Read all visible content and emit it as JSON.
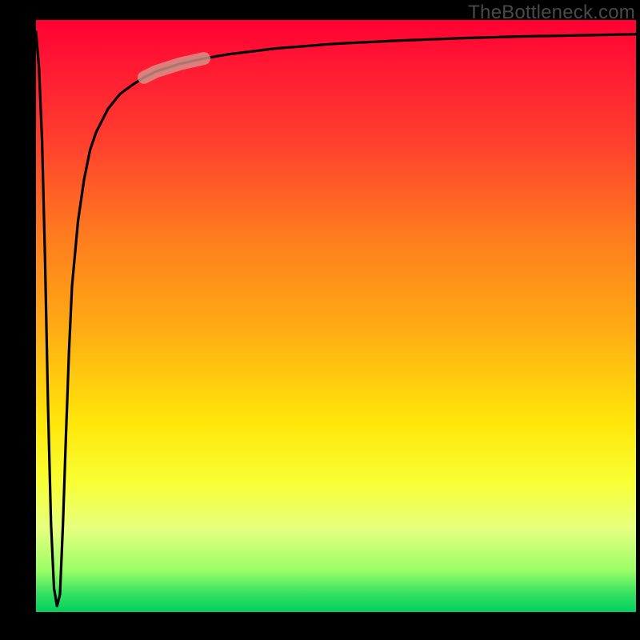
{
  "watermark": "TheBottleneck.com",
  "colors": {
    "background": "#000000",
    "gradient_top": "#ff0033",
    "gradient_mid": "#ffe60a",
    "gradient_bottom": "#00d060",
    "curve": "#000000",
    "highlight": "#d49b8e"
  },
  "chart_data": {
    "type": "line",
    "title": "",
    "xlabel": "",
    "ylabel": "",
    "xlim": [
      0,
      100
    ],
    "ylim": [
      0,
      100
    ],
    "grid": false,
    "legend": false,
    "annotations": [
      "TheBottleneck.com"
    ],
    "description": "Single black curve on a vertical red-to-green gradient background. The curve starts near the top-left, plunges almost vertically to the bottom-left corner, then rises steeply and asymptotically flattens toward the top-right. A short pale-pink highlighted band sits on the curve during the sharp upper-left ascent.",
    "series": [
      {
        "name": "bottleneck-curve",
        "x": [
          0.0,
          0.5,
          1.0,
          1.5,
          2.0,
          2.5,
          3.0,
          3.5,
          4.0,
          4.5,
          5.0,
          5.5,
          6.0,
          7.0,
          8.0,
          9.0,
          10.0,
          12.0,
          14.0,
          16.0,
          18.0,
          20.0,
          24.0,
          28.0,
          32.0,
          40.0,
          50.0,
          60.0,
          70.0,
          80.0,
          90.0,
          100.0
        ],
        "y": [
          98.0,
          92.0,
          80.0,
          60.0,
          35.0,
          15.0,
          4.0,
          1.0,
          3.0,
          15.0,
          30.0,
          44.0,
          55.0,
          66.0,
          73.0,
          78.0,
          81.0,
          85.0,
          87.5,
          89.0,
          90.3,
          91.3,
          92.6,
          93.5,
          94.2,
          95.2,
          96.0,
          96.5,
          96.9,
          97.2,
          97.4,
          97.6
        ]
      }
    ],
    "highlight_segment": {
      "series": "bottleneck-curve",
      "x_range": [
        18.0,
        28.0
      ],
      "note": "pale pink marker over part of the rising curve"
    }
  }
}
